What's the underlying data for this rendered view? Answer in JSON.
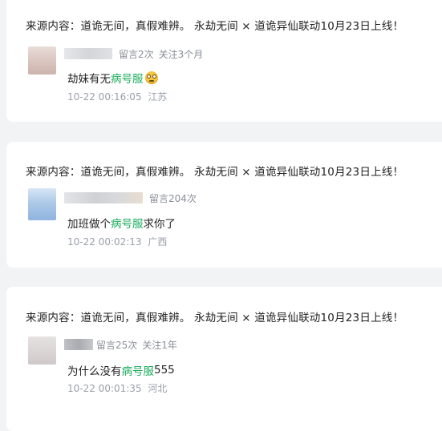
{
  "comments": [
    {
      "source": "来源内容：道诡无间，真假难辨。 永劫无间 × 道诡异仙联动10月23日上线！",
      "meta_count": "留言2次",
      "meta_follow": "关注3个月",
      "text_before": "劫妹有无",
      "text_highlight": "病号服",
      "text_after": "",
      "emoji": "flushed-face-icon",
      "time": "10-22 00:16:05",
      "location": "江苏"
    },
    {
      "source": "来源内容：道诡无间，真假难辨。 永劫无间 × 道诡异仙联动10月23日上线！",
      "meta_count": "留言204次",
      "meta_follow": "",
      "text_before": "加班做个",
      "text_highlight": "病号服",
      "text_after": "求你了",
      "time": "10-22 00:02:13",
      "location": "广西"
    },
    {
      "source": "来源内容：道诡无间，真假难辨。 永劫无间 × 道诡异仙联动10月23日上线！",
      "meta_count": "留言25次",
      "meta_follow": "关注1年",
      "text_before": "为什么没有",
      "text_highlight": "病号服",
      "text_after": "555",
      "time": "10-22 00:01:35",
      "location": "河北"
    }
  ],
  "colors": {
    "highlight": "#1aad5b",
    "card_bg": "#ffffff",
    "page_bg": "#f2f3f5"
  }
}
